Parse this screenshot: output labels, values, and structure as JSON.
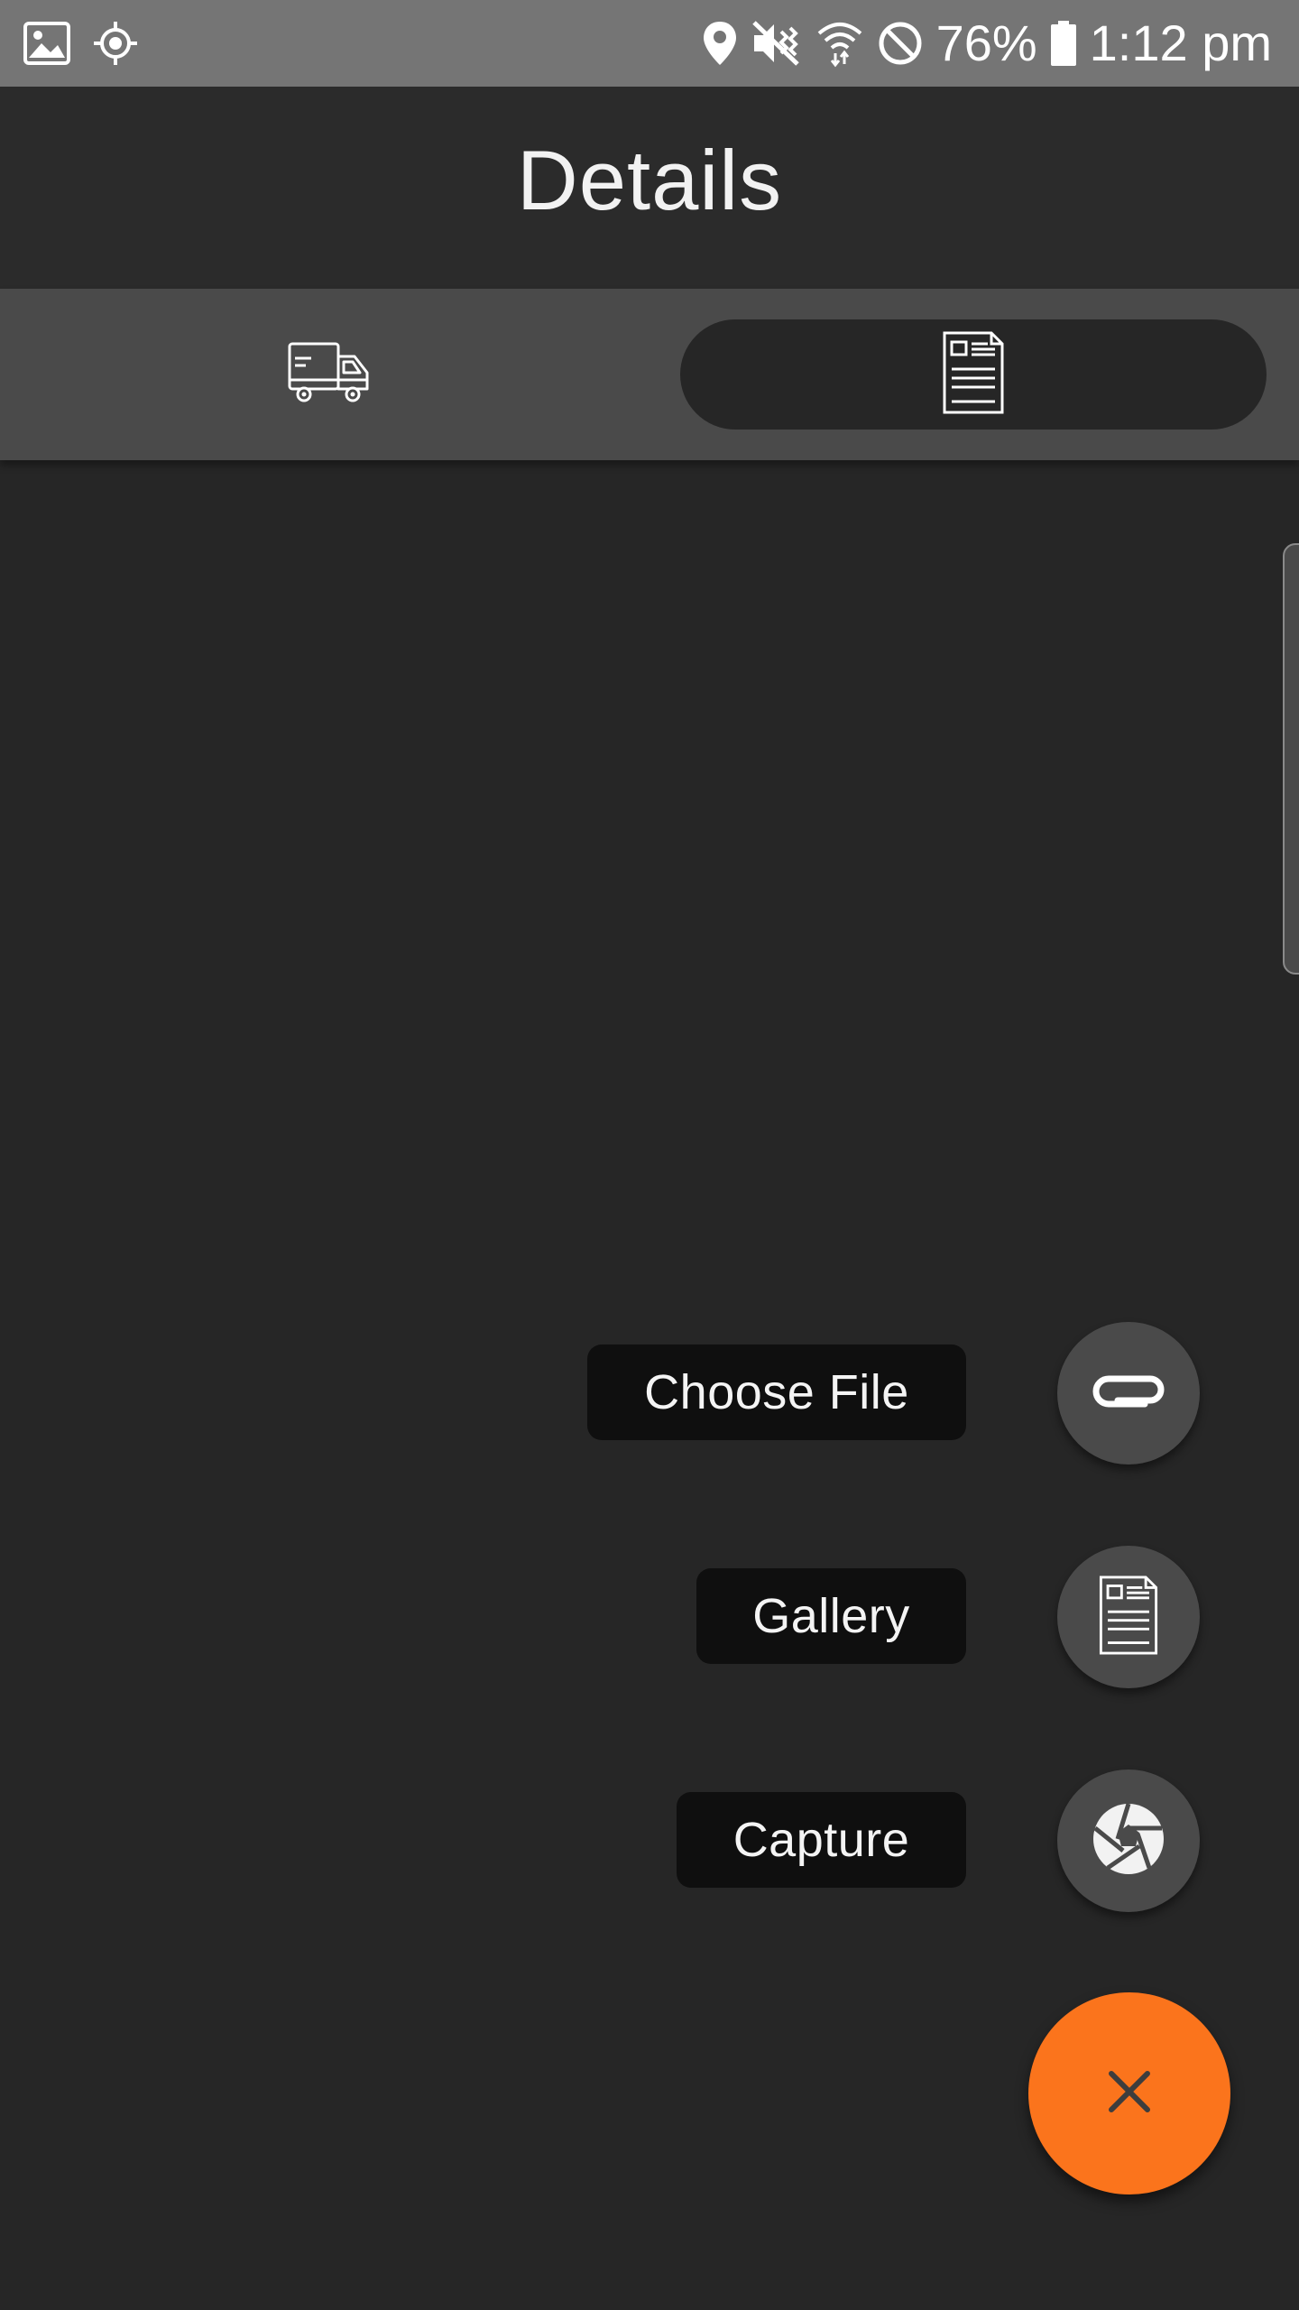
{
  "status_bar": {
    "battery_percent": "76%",
    "time": "1:12 pm",
    "icons": [
      "image-icon",
      "location-target-icon",
      "location-pin-icon",
      "vibrate-mute-icon",
      "wifi-icon",
      "do-not-disturb-icon",
      "battery-icon"
    ]
  },
  "header": {
    "title": "Details"
  },
  "tabs": [
    {
      "icon": "truck-icon",
      "selected": false
    },
    {
      "icon": "document-icon",
      "selected": true
    }
  ],
  "fab_menu": {
    "items": [
      {
        "label": "Choose File",
        "icon": "paperclip-icon"
      },
      {
        "label": "Gallery",
        "icon": "document-icon"
      },
      {
        "label": "Capture",
        "icon": "camera-shutter-icon"
      }
    ],
    "close_icon": "close-icon"
  },
  "colors": {
    "background": "#262626",
    "status_bar": "#757575",
    "app_bar": "#2b2b2b",
    "tab_bar": "#4a4a4a",
    "accent": "#fb741c",
    "label_background": "#0f0f0f"
  }
}
